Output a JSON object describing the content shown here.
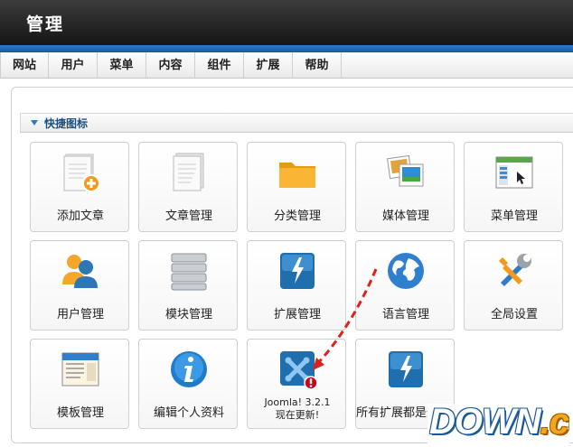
{
  "header": {
    "title": "管理"
  },
  "menu": [
    "网站",
    "用户",
    "菜单",
    "内容",
    "组件",
    "扩展",
    "帮助"
  ],
  "panel": {
    "title": "快捷图标"
  },
  "tiles": [
    {
      "label": "添加文章",
      "icon": "add-article-icon"
    },
    {
      "label": "文章管理",
      "icon": "article-manager-icon"
    },
    {
      "label": "分类管理",
      "icon": "folder-icon"
    },
    {
      "label": "媒体管理",
      "icon": "media-icon"
    },
    {
      "label": "菜单管理",
      "icon": "menu-manager-icon"
    },
    {
      "label": "用户管理",
      "icon": "users-icon"
    },
    {
      "label": "模块管理",
      "icon": "modules-icon"
    },
    {
      "label": "扩展管理",
      "icon": "extension-icon"
    },
    {
      "label": "语言管理",
      "icon": "globe-icon"
    },
    {
      "label": "全局设置",
      "icon": "tools-icon"
    },
    {
      "label": "模板管理",
      "icon": "template-icon"
    },
    {
      "label": "编辑个人资料",
      "icon": "info-icon"
    },
    {
      "label_line1": "Joomla! 3.2.1",
      "label_line2": "现在更新!",
      "icon": "joomla-update-icon"
    },
    {
      "label": "所有扩展都是最新版",
      "icon": "extension-update-icon"
    }
  ],
  "watermark": {
    "main": "DOWN",
    "suffix": ".cc"
  },
  "colors": {
    "accent": "#1a6fb5",
    "header_bg": "#1f1f1f",
    "alert": "#d0021b"
  }
}
